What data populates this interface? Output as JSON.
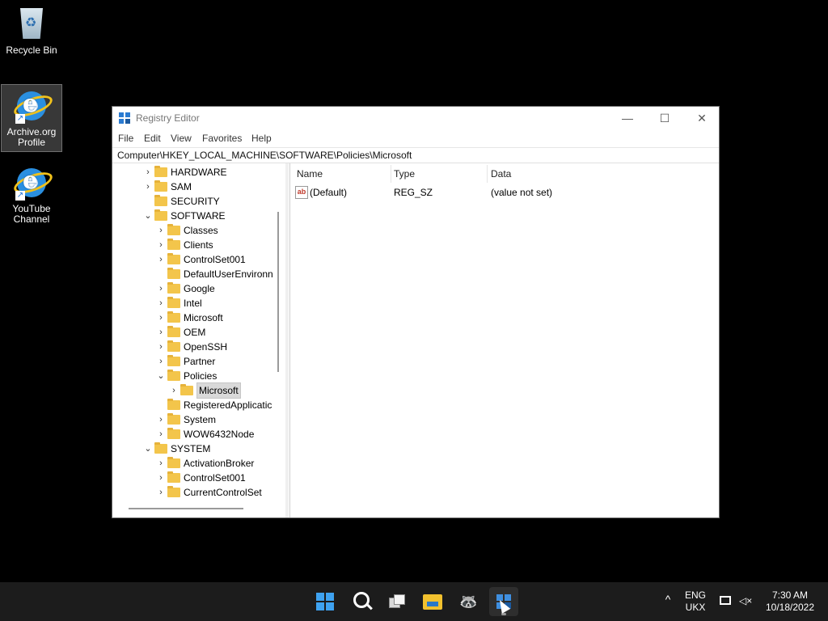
{
  "desktop": {
    "icons": [
      {
        "label": "Recycle Bin"
      },
      {
        "label": "Archive.org\nProfile"
      },
      {
        "label": "YouTube\nChannel"
      }
    ]
  },
  "window": {
    "title": "Registry Editor",
    "controls": {
      "minimize": "—",
      "maximize": "☐",
      "close": "✕"
    },
    "menu": [
      "File",
      "Edit",
      "View",
      "Favorites",
      "Help"
    ],
    "address": "Computer\\HKEY_LOCAL_MACHINE\\SOFTWARE\\Policies\\Microsoft",
    "tree": [
      {
        "label": "HARDWARE",
        "chevron": ">"
      },
      {
        "label": "SAM",
        "chevron": ">"
      },
      {
        "label": "SECURITY",
        "chevron": ""
      },
      {
        "label": "SOFTWARE",
        "chevron": "v"
      },
      {
        "label": "Classes",
        "chevron": ">"
      },
      {
        "label": "Clients",
        "chevron": ">"
      },
      {
        "label": "ControlSet001",
        "chevron": ">"
      },
      {
        "label": "DefaultUserEnvironn",
        "chevron": ""
      },
      {
        "label": "Google",
        "chevron": ">"
      },
      {
        "label": "Intel",
        "chevron": ">"
      },
      {
        "label": "Microsoft",
        "chevron": ">"
      },
      {
        "label": "OEM",
        "chevron": ">"
      },
      {
        "label": "OpenSSH",
        "chevron": ">"
      },
      {
        "label": "Partner",
        "chevron": ">"
      },
      {
        "label": "Policies",
        "chevron": "v"
      },
      {
        "label": "Microsoft",
        "chevron": ">"
      },
      {
        "label": "RegisteredApplicatic",
        "chevron": ""
      },
      {
        "label": "System",
        "chevron": ">"
      },
      {
        "label": "WOW6432Node",
        "chevron": ">"
      },
      {
        "label": "SYSTEM",
        "chevron": "v"
      },
      {
        "label": "ActivationBroker",
        "chevron": ">"
      },
      {
        "label": "ControlSet001",
        "chevron": ">"
      },
      {
        "label": "CurrentControlSet",
        "chevron": ">"
      }
    ],
    "list": {
      "columns": [
        "Name",
        "Type",
        "Data"
      ],
      "rows": [
        {
          "icon": "ab",
          "name": "(Default)",
          "type": "REG_SZ",
          "data": "(value not set)"
        }
      ]
    }
  },
  "taskbar": {
    "tray": {
      "lang_top": "ENG",
      "lang_bottom": "UKX",
      "time": "7:30 AM",
      "date": "10/18/2022",
      "chevron": "^"
    }
  },
  "colors": {
    "accent": "#3ea2f0",
    "folder": "#f3c54b",
    "taskbar": "#1c1c1c"
  }
}
